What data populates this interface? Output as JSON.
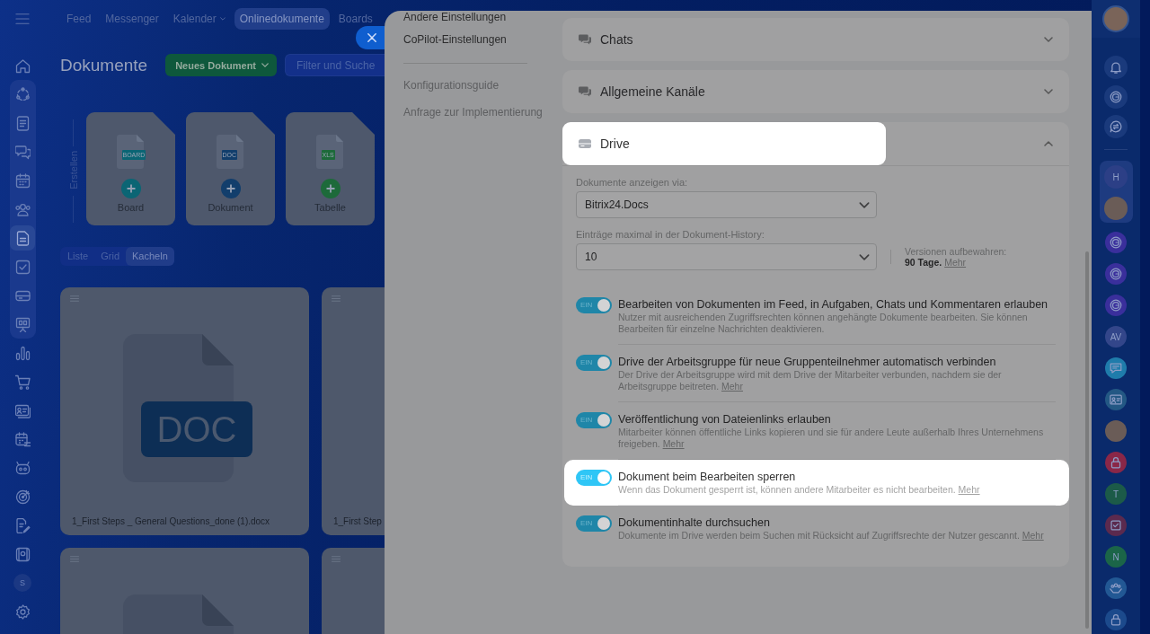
{
  "sidebar": {
    "sections": [
      {
        "grouped": false,
        "items": [
          {
            "kind": "icon",
            "selected": false
          }
        ]
      },
      {
        "grouped": true,
        "items": [
          {
            "kind": "icon",
            "selected": false
          },
          {
            "kind": "icon",
            "selected": false
          },
          {
            "kind": "icon",
            "selected": false
          },
          {
            "kind": "icon",
            "selected": false
          },
          {
            "kind": "icon",
            "selected": false
          },
          {
            "kind": "icon",
            "selected": true
          },
          {
            "kind": "icon",
            "selected": false
          },
          {
            "kind": "icon",
            "selected": false
          },
          {
            "kind": "icon",
            "selected": false
          }
        ]
      },
      {
        "grouped": false,
        "items": [
          {
            "kind": "icon",
            "selected": false
          },
          {
            "kind": "icon",
            "selected": false
          },
          {
            "kind": "icon",
            "selected": false
          },
          {
            "kind": "icon",
            "selected": false
          },
          {
            "kind": "icon",
            "selected": false
          },
          {
            "kind": "icon",
            "selected": false
          },
          {
            "kind": "icon",
            "selected": false
          },
          {
            "kind": "icon",
            "selected": false
          },
          {
            "kind": "initials",
            "text": "S",
            "selected": false
          },
          {
            "kind": "icon",
            "selected": false
          }
        ]
      }
    ]
  },
  "top_nav": [
    {
      "label": "Feed",
      "selected": false,
      "dropdown": false
    },
    {
      "label": "Messenger",
      "selected": false,
      "dropdown": false
    },
    {
      "label": "Kalender",
      "selected": false,
      "dropdown": true
    },
    {
      "label": "Onlinedokumente",
      "selected": true,
      "dropdown": false
    },
    {
      "label": "Boards",
      "selected": false,
      "dropdown": false
    }
  ],
  "documents": {
    "title": "Dokumente",
    "new_button": "Neues Dokument",
    "filter": {
      "placeholder": "Filter und Suche"
    },
    "create": {
      "label": "Erstellen",
      "items": [
        {
          "label": "Board",
          "badge": "BOARD",
          "color": "#0b6574"
        },
        {
          "label": "Dokument",
          "badge": "DOC",
          "color": "#123e6c"
        },
        {
          "label": "Tabelle",
          "badge": "XLS",
          "color": "#1d6a3a"
        }
      ]
    },
    "views": [
      {
        "label": "Liste",
        "selected": false
      },
      {
        "label": "Grid",
        "selected": false
      },
      {
        "label": "Kacheln",
        "selected": true
      }
    ],
    "files": [
      {
        "kind": "document",
        "badge": "DOC",
        "name": "1_First Steps _ General Questions_done (1).docx"
      },
      {
        "kind": "blank",
        "name": "1_First Step"
      },
      {
        "kind": "document"
      },
      {
        "kind": "blank"
      }
    ]
  },
  "settings": {
    "nav": [
      "Andere Einstellungen",
      "CoPilot-Einstellungen"
    ],
    "help_links": [
      "Konfigurationsguide",
      "Anfrage zur Implementierung"
    ],
    "sections": [
      {
        "title": "Chats",
        "expanded": false,
        "highlighted": false
      },
      {
        "title": "Allgemeine Kanäle",
        "expanded": false,
        "highlighted": false
      },
      {
        "title": "Drive",
        "expanded": true,
        "highlighted": true,
        "selects": [
          {
            "label": "Dokumente anzeigen via:",
            "value": "Bitrix24.Docs"
          },
          {
            "label": "Einträge maximal in der Dokument-History:",
            "value": "10",
            "note": {
              "label": "Versionen aufbewahren:",
              "value": "90 Tage.",
              "link": "Mehr"
            }
          }
        ],
        "toggles": [
          {
            "title": "Bearbeiten von Dokumenten im Feed, in Aufgaben, Chats und Kommentaren erlauben",
            "description": "Nutzer mit ausreichenden Zugriffsrechten können angehängte Dokumente bearbeiten. Sie können Bearbeiten für einzelne Nachrichten deaktivieren.",
            "on": true,
            "switch_text": "EIN",
            "highlighted": false
          },
          {
            "title": "Drive der Arbeitsgruppe für neue Gruppenteilnehmer automatisch verbinden",
            "description": "Der Drive der Arbeitsgruppe wird mit dem Drive der Mitarbeiter verbunden, nachdem sie der Arbeitsgruppe beitreten.",
            "link": "Mehr",
            "on": true,
            "switch_text": "EIN",
            "highlighted": false
          },
          {
            "title": "Veröffentlichung von Dateienlinks erlauben",
            "description": "Mitarbeiter können öffentliche Links kopieren und sie für andere Leute außerhalb Ihres Unternehmens freigeben.",
            "link": "Mehr",
            "on": true,
            "switch_text": "EIN",
            "highlighted": false
          },
          {
            "title": "Dokument beim Bearbeiten sperren",
            "description": "Wenn das Dokument gesperrt ist, können andere Mitarbeiter es nicht bearbeiten.",
            "link": "Mehr",
            "on": true,
            "switch_text": "EIN",
            "highlighted": true
          },
          {
            "title": "Dokumentinhalte durchsuchen",
            "description": "Dokumente im Drive werden beim Suchen mit Rücksicht auf Zugriffsrechte der Nutzer gescannt.",
            "link": "Mehr",
            "on": true,
            "switch_text": "EIN",
            "highlighted": false
          }
        ]
      }
    ]
  },
  "right_bar": {
    "sections": [
      {
        "grouped": false,
        "items": [
          {
            "kind": "icon",
            "color": "#1a3a7c"
          },
          {
            "kind": "icon",
            "color": "#1a3a7c"
          },
          {
            "kind": "icon",
            "color": "#1a3a7c"
          }
        ]
      },
      {
        "grouped": true,
        "items": [
          {
            "kind": "initials",
            "text": "H",
            "color": "#2c3f86"
          },
          {
            "kind": "photo"
          }
        ]
      },
      {
        "grouped": false,
        "items": [
          {
            "kind": "icon",
            "color": "#3a2f9c"
          },
          {
            "kind": "icon",
            "color": "#3a2f9c"
          },
          {
            "kind": "icon",
            "color": "#3a2f9c"
          },
          {
            "kind": "initials",
            "text": "AV",
            "color": "#33468a"
          },
          {
            "kind": "icon",
            "color": "#1f7cab"
          },
          {
            "kind": "icon",
            "color": "#235884"
          },
          {
            "kind": "photo"
          },
          {
            "kind": "icon",
            "color": "#8a2748"
          },
          {
            "kind": "initials",
            "text": "T",
            "color": "#1c5a48"
          },
          {
            "kind": "icon",
            "color": "#5b2a4e"
          },
          {
            "kind": "initials",
            "text": "N",
            "color": "#1b6548"
          },
          {
            "kind": "icon",
            "color": "#225894"
          },
          {
            "kind": "icon",
            "color": "#1c4a8c"
          }
        ]
      }
    ]
  }
}
